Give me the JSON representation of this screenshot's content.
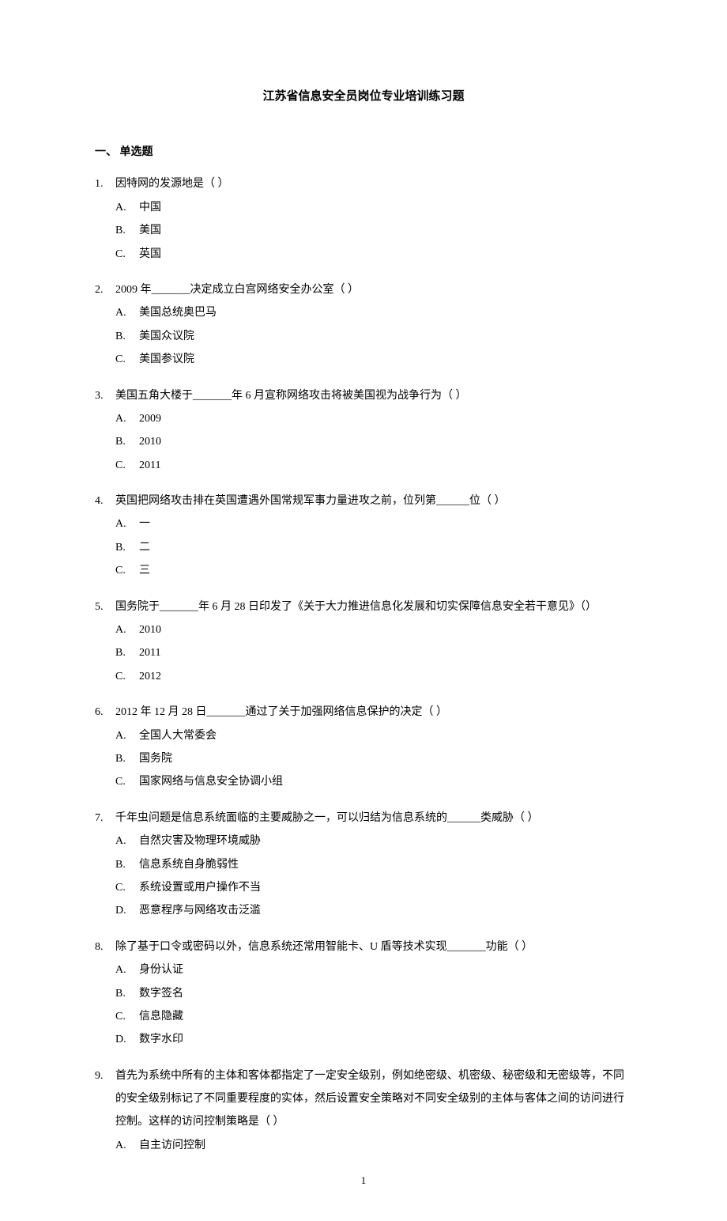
{
  "title": "江苏省信息安全员岗位专业培训练习题",
  "section_heading": "一、 单选题",
  "page_number": "1",
  "questions": [
    {
      "num": "1.",
      "text": "因特网的发源地是（   ）",
      "options": [
        {
          "label": "A.",
          "text": "中国"
        },
        {
          "label": "B.",
          "text": "美国"
        },
        {
          "label": "C.",
          "text": "英国"
        }
      ]
    },
    {
      "num": "2.",
      "text": "2009 年_______决定成立白宫网络安全办公室（   ）",
      "options": [
        {
          "label": "A.",
          "text": "美国总统奥巴马"
        },
        {
          "label": "B.",
          "text": "美国众议院"
        },
        {
          "label": "C.",
          "text": "美国参议院"
        }
      ]
    },
    {
      "num": "3.",
      "text": "美国五角大楼于_______年 6 月宣称网络攻击将被美国视为战争行为（     ）",
      "options": [
        {
          "label": "A.",
          "text": "2009"
        },
        {
          "label": "B.",
          "text": "2010"
        },
        {
          "label": "C.",
          "text": "2011"
        }
      ]
    },
    {
      "num": "4.",
      "text": "英国把网络攻击排在英国遭遇外国常规军事力量进攻之前，位列第______位（     ）",
      "options": [
        {
          "label": "A.",
          "text": "一"
        },
        {
          "label": "B.",
          "text": "二"
        },
        {
          "label": "C.",
          "text": "三"
        }
      ]
    },
    {
      "num": "5.",
      "text": "国务院于_______年 6 月 28 日印发了《关于大力推进信息化发展和切实保障信息安全若干意见》（）",
      "options": [
        {
          "label": "A.",
          "text": "2010"
        },
        {
          "label": "B.",
          "text": "2011"
        },
        {
          "label": "C.",
          "text": "2012"
        }
      ]
    },
    {
      "num": "6.",
      "text": "2012 年 12 月 28 日_______通过了关于加强网络信息保护的决定（   ）",
      "options": [
        {
          "label": "A.",
          "text": "全国人大常委会"
        },
        {
          "label": "B.",
          "text": "国务院"
        },
        {
          "label": "C.",
          "text": "国家网络与信息安全协调小组"
        }
      ]
    },
    {
      "num": "7.",
      "text": "千年虫问题是信息系统面临的主要威胁之一，可以归结为信息系统的______类威胁（   ）",
      "options": [
        {
          "label": "A.",
          "text": "自然灾害及物理环境威胁"
        },
        {
          "label": "B.",
          "text": "信息系统自身脆弱性"
        },
        {
          "label": "C.",
          "text": "系统设置或用户操作不当"
        },
        {
          "label": "D.",
          "text": "恶意程序与网络攻击泛滥"
        }
      ]
    },
    {
      "num": "8.",
      "text": "除了基于口令或密码以外，信息系统还常用智能卡、U 盾等技术实现_______功能（   ）",
      "options": [
        {
          "label": "A.",
          "text": "身份认证"
        },
        {
          "label": "B.",
          "text": "数字签名"
        },
        {
          "label": "C.",
          "text": "信息隐藏"
        },
        {
          "label": "D.",
          "text": "数字水印"
        }
      ]
    },
    {
      "num": "9.",
      "text": "首先为系统中所有的主体和客体都指定了一定安全级别，例如绝密级、机密级、秘密级和无密级等，不同的安全级别标记了不同重要程度的实体，然后设置安全策略对不同安全级别的主体与客体之间的访问进行控制。这样的访问控制策略是（   ）",
      "options": [
        {
          "label": "A.",
          "text": "自主访问控制"
        }
      ]
    }
  ]
}
